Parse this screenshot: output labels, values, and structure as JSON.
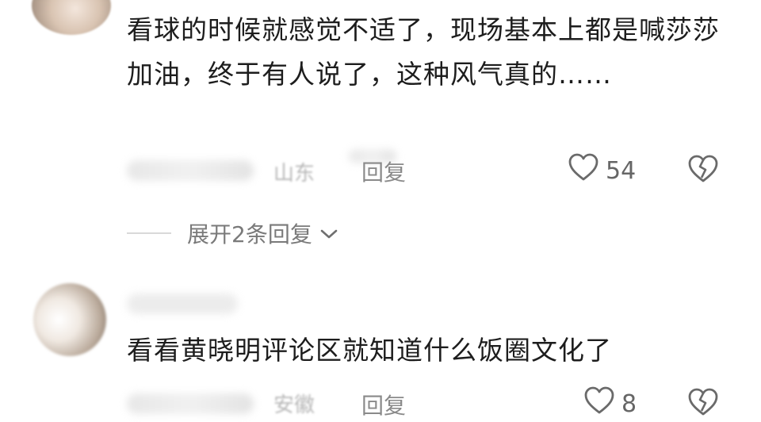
{
  "comments": [
    {
      "text": "看球的时候就感觉不适了，现场基本上都是喊莎莎加油，终于有人说了，这种风气真的……",
      "location": "山东",
      "reply_label": "回复",
      "likes": "54"
    },
    {
      "text": "看看黄晓明评论区就知道什么饭圈文化了",
      "location": "安徽",
      "reply_label": "回复",
      "likes": "8"
    }
  ],
  "expand_replies_label": "展开2条回复",
  "icons": {
    "like": "heart-outline-icon",
    "dislike": "broken-heart-icon",
    "expand": "chevron-down-icon"
  }
}
